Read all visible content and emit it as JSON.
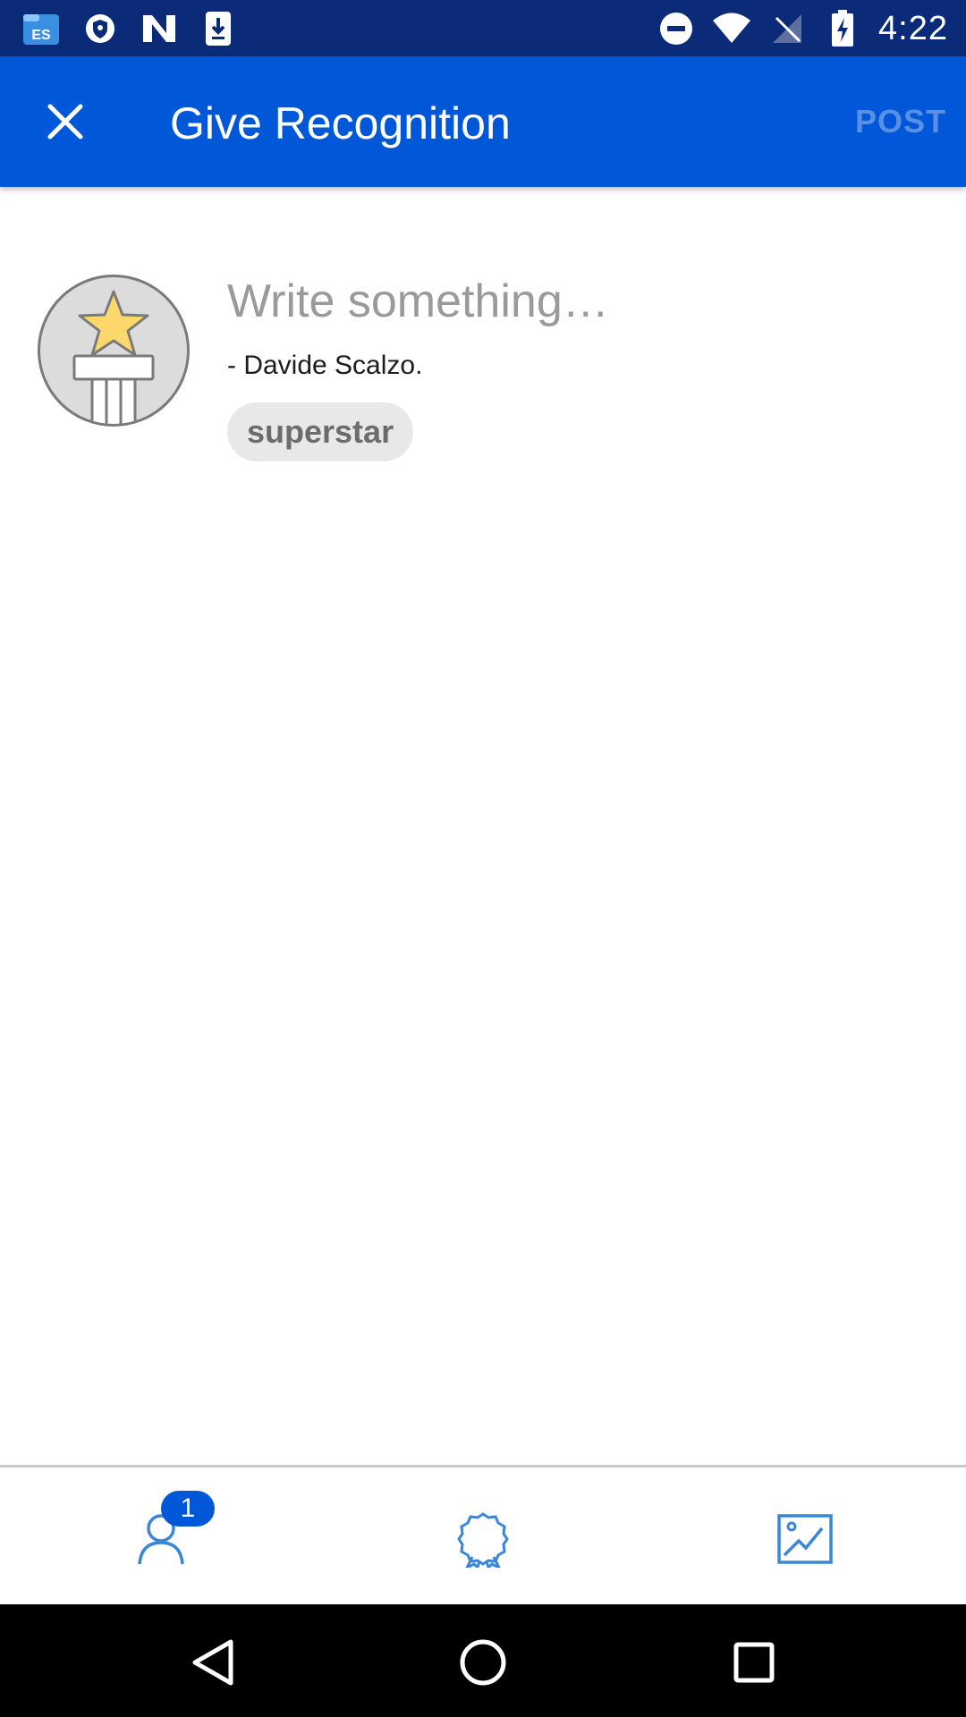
{
  "status_bar": {
    "time": "4:22",
    "icons_left": [
      "file-manager-icon",
      "vpn-shield-icon",
      "n-app-icon",
      "download-icon"
    ],
    "icons_right": [
      "do-not-disturb-icon",
      "wifi-icon",
      "no-signal-icon",
      "battery-charging-icon"
    ]
  },
  "app_bar": {
    "title": "Give Recognition",
    "post_label": "POST",
    "close_icon": "close-icon"
  },
  "composer": {
    "placeholder": "Write something…",
    "signature": "- Davide Scalzo.",
    "tag": "superstar",
    "avatar_icon": "star-podium-icon"
  },
  "toolbar": {
    "people_badge": "1",
    "icons": [
      "people-icon",
      "award-icon",
      "image-icon"
    ]
  },
  "nav_bar": {
    "icons": [
      "back-icon",
      "home-icon",
      "recents-icon"
    ]
  },
  "colors": {
    "status_bar": "#0b2a78",
    "app_bar": "#0057d8",
    "post_disabled": "#5a8fe6",
    "toolbar_icon": "#3a86d9"
  }
}
